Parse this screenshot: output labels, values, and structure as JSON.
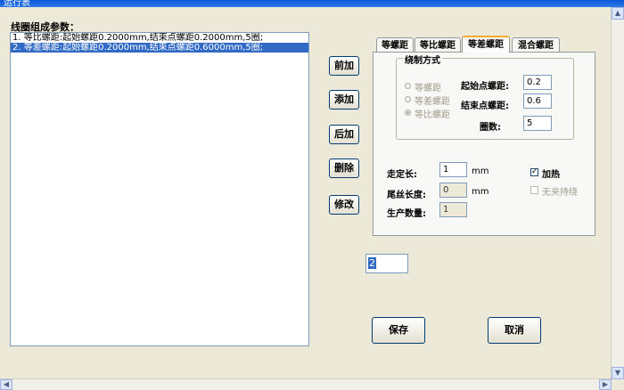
{
  "window": {
    "title": "运行表"
  },
  "list": {
    "label": "线圈组成参数：",
    "items": [
      {
        "text": "1. 等比螺距:起始螺距0.2000mm,结束点螺距0.2000mm,5圈;",
        "selected": false
      },
      {
        "text": "2. 等差螺距:起始螺距0.2000mm,结束点螺距0.6000mm,5圈;",
        "selected": true
      }
    ]
  },
  "buttons": {
    "front_add": "前加",
    "add": "添加",
    "back_add": "后加",
    "delete": "删除",
    "modify": "修改",
    "save": "保存",
    "cancel": "取消"
  },
  "tabs": [
    {
      "label": "等螺距",
      "active": false
    },
    {
      "label": "等比螺距",
      "active": false
    },
    {
      "label": "等差螺距",
      "active": true
    },
    {
      "label": "混合螺距",
      "active": false
    }
  ],
  "winding": {
    "group_title": "绕制方式",
    "radios": [
      {
        "label": "等螺距",
        "checked": false
      },
      {
        "label": "等差螺距",
        "checked": false
      },
      {
        "label": "等比螺距",
        "checked": true
      }
    ],
    "start_pitch_label": "起始点螺距:",
    "start_pitch_value": "0.2",
    "end_pitch_label": "结束点螺距:",
    "end_pitch_value": "0.6",
    "turns_label": "圈数:",
    "turns_value": "5"
  },
  "params": {
    "feed_length_label": "走定长:",
    "feed_length_value": "1",
    "feed_length_unit": "mm",
    "tail_length_label": "尾丝长度:",
    "tail_length_value": "0",
    "tail_length_unit": "mm",
    "production_qty_label": "生产数量:",
    "production_qty_value": "1",
    "heating_label": "加热",
    "heating_checked": true,
    "no_clamp_label": "无夹持绕",
    "no_clamp_checked": false
  },
  "small_input": {
    "value": "2"
  }
}
